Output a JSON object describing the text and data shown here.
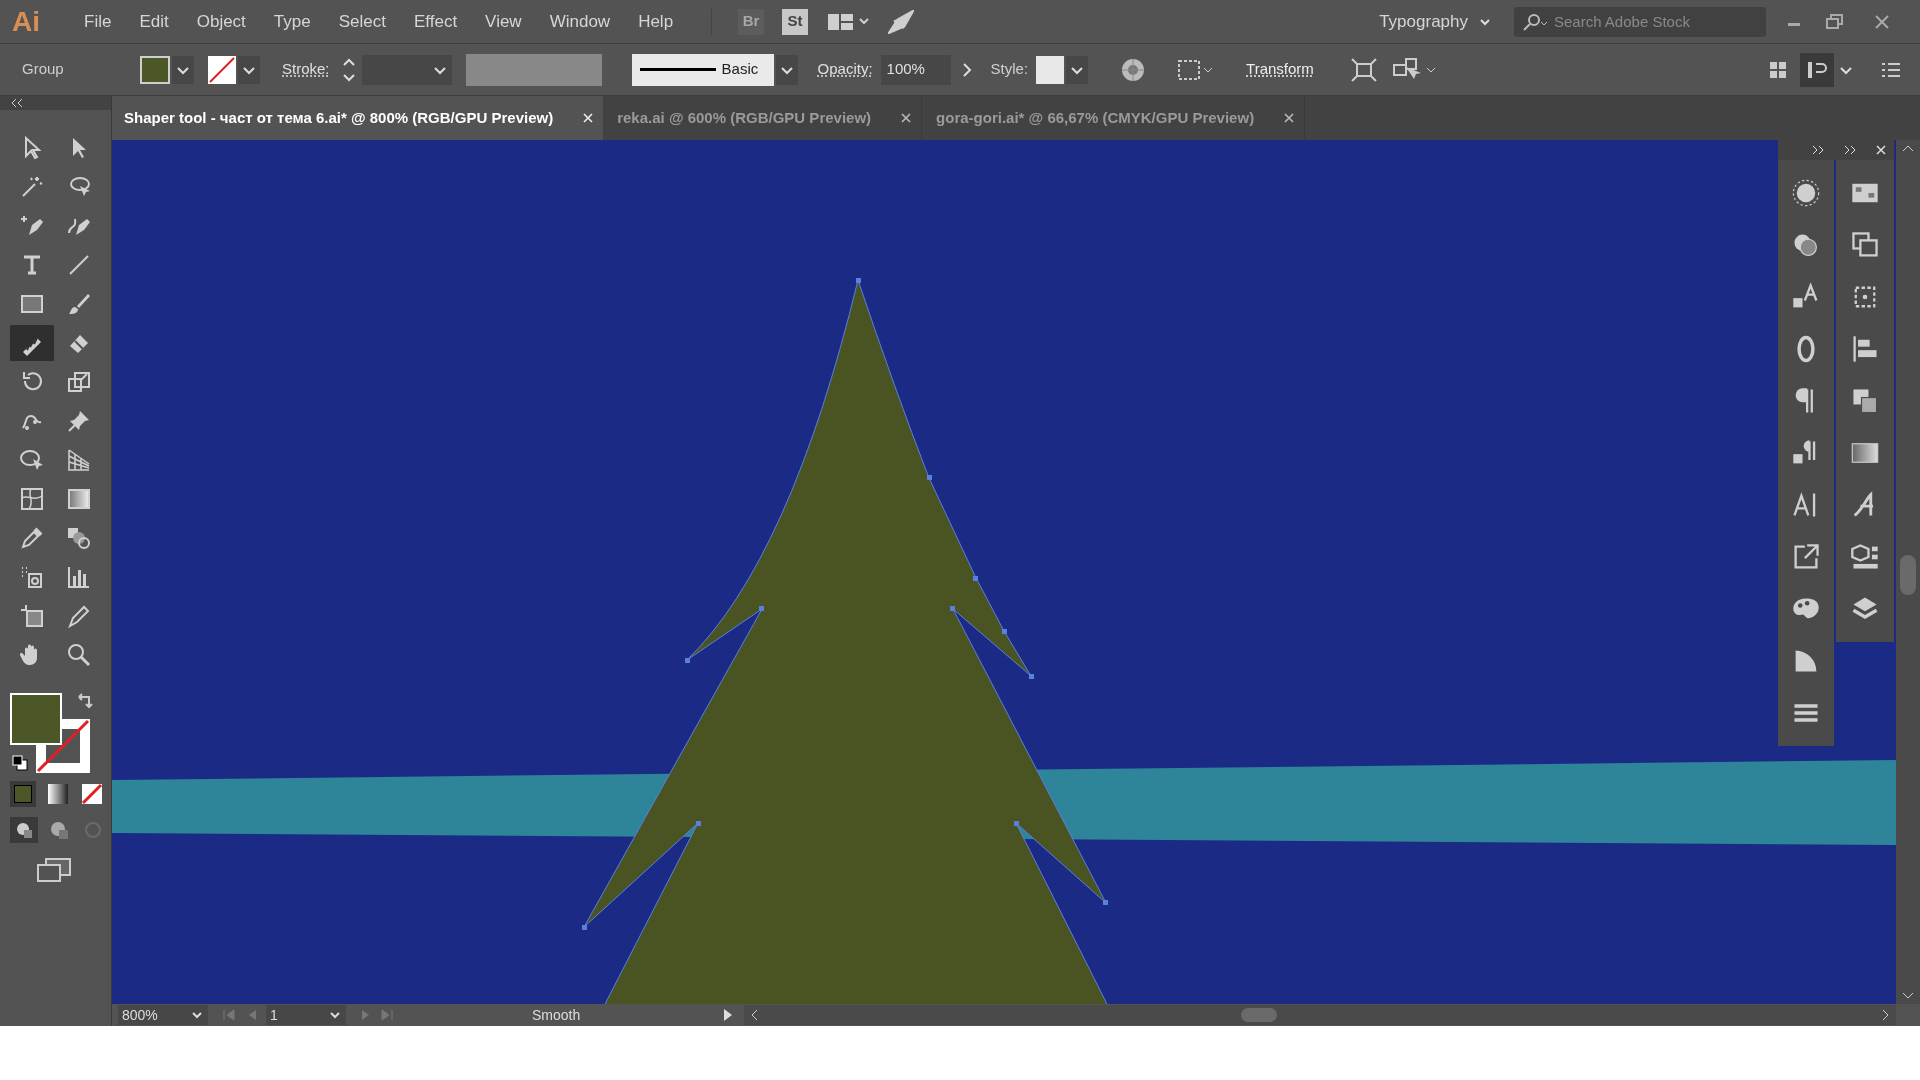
{
  "app": {
    "logo": "Ai",
    "bridge": "Br",
    "stock": "St"
  },
  "menu": [
    "File",
    "Edit",
    "Object",
    "Type",
    "Select",
    "Effect",
    "View",
    "Window",
    "Help"
  ],
  "workspace": {
    "label": "Typography"
  },
  "search": {
    "placeholder": "Search Adobe Stock"
  },
  "control_bar": {
    "selection": "Group",
    "stroke_label": "Stroke:",
    "brush": "Basic",
    "opacity_label": "Opacity:",
    "opacity": "100%",
    "style_label": "Style:",
    "transform": "Transform"
  },
  "tabs": [
    {
      "label": "Shaper tool - част от тема 6.ai* @ 800% (RGB/GPU Preview)",
      "selected": true
    },
    {
      "label": "reka.ai @ 600% (RGB/GPU Preview)",
      "selected": false
    },
    {
      "label": "gora-gori.ai* @ 66,67% (CMYK/GPU Preview)",
      "selected": false
    }
  ],
  "tools": [
    {
      "kind": "selection",
      "selected": false
    },
    {
      "kind": "direct",
      "selected": false
    },
    {
      "kind": "wand",
      "selected": false
    },
    {
      "kind": "lasso",
      "selected": false
    },
    {
      "kind": "pen",
      "selected": false
    },
    {
      "kind": "curvature",
      "selected": false
    },
    {
      "kind": "type",
      "selected": false
    },
    {
      "kind": "line",
      "selected": false
    },
    {
      "kind": "rectangle",
      "selected": false
    },
    {
      "kind": "brush",
      "selected": false
    },
    {
      "kind": "shaper",
      "selected": true
    },
    {
      "kind": "eraser",
      "selected": false
    },
    {
      "kind": "rotate",
      "selected": false
    },
    {
      "kind": "scale",
      "selected": false
    },
    {
      "kind": "warp",
      "selected": false
    },
    {
      "kind": "pin",
      "selected": false
    },
    {
      "kind": "shapebuilder",
      "selected": false
    },
    {
      "kind": "perspective",
      "selected": false
    },
    {
      "kind": "mesh",
      "selected": false
    },
    {
      "kind": "gradient",
      "selected": false
    },
    {
      "kind": "eyedropper",
      "selected": false
    },
    {
      "kind": "blend",
      "selected": false
    },
    {
      "kind": "sprayer",
      "selected": false
    },
    {
      "kind": "graph",
      "selected": false
    },
    {
      "kind": "artboard",
      "selected": false
    },
    {
      "kind": "slice",
      "selected": false
    },
    {
      "kind": "hand",
      "selected": false
    },
    {
      "kind": "zoom",
      "selected": false
    }
  ],
  "status_bar": {
    "zoom": "800%",
    "artboard": "1",
    "tool": "Smooth"
  }
}
